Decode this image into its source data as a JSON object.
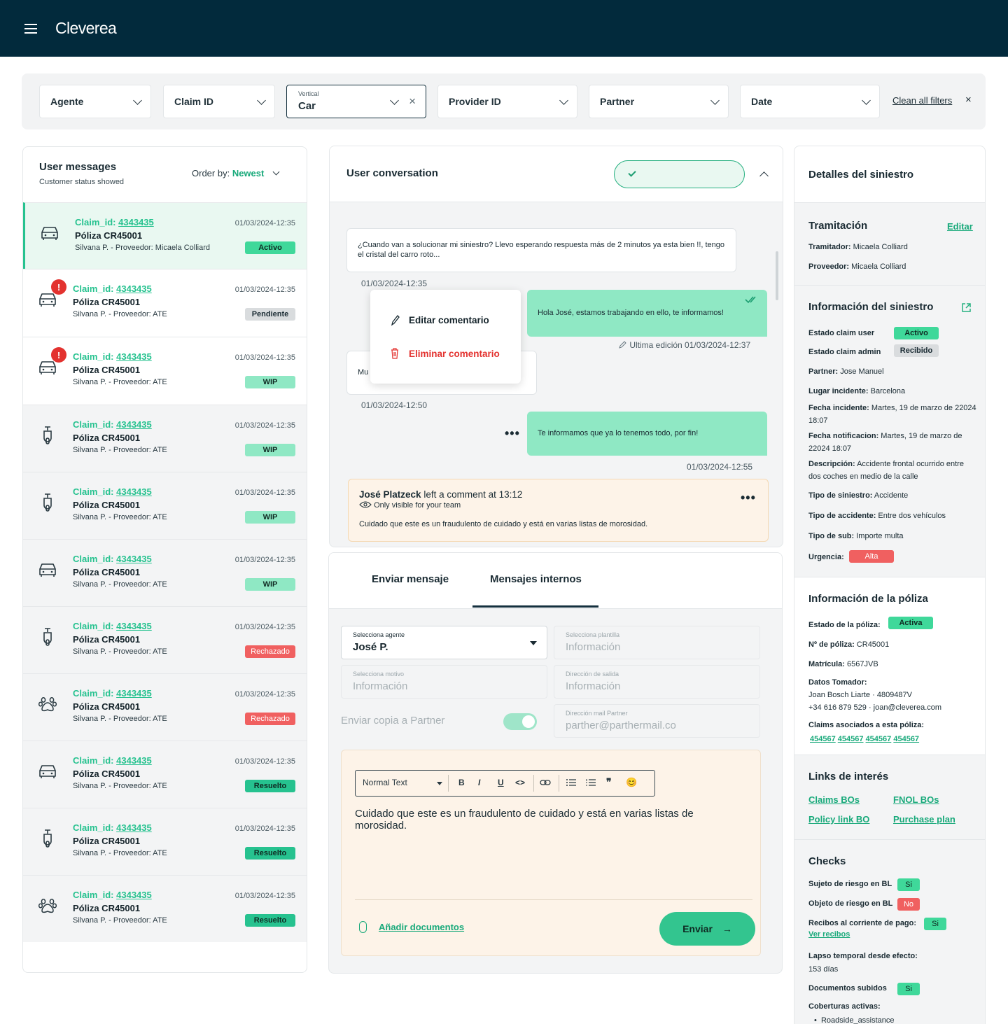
{
  "app": {
    "brand": "Cleverea"
  },
  "colors": {
    "accent": "#26c28f",
    "header_bg": "#022a3c",
    "danger": "#f06060",
    "pending": "#d9dcde"
  },
  "filters": {
    "agente": "Agente",
    "claim_id": "Claim ID",
    "vertical_label": "Vertical",
    "vertical_value": "Car",
    "provider_id": "Provider ID",
    "partner": "Partner",
    "date": "Date",
    "clean": "Clean all filters",
    "clean_x": "×",
    "vertical_x": "×"
  },
  "messages": {
    "title": "User messages",
    "subtitle": "Customer status showed",
    "order_label": "Order by:",
    "order_value": "Newest",
    "items": [
      {
        "prefix": "Claim_id: ",
        "id": "4343435",
        "poliza": "Póliza CR45001",
        "provider": "Silvana P. - Proveedor: Micaela Colliard",
        "date": "01/03/2024-12:35",
        "status": "Activo",
        "icon": "car-icon",
        "alert": ""
      },
      {
        "prefix": "Claim_id: ",
        "id": "4343435",
        "poliza": "Póliza CR45001",
        "provider": "Silvana P. - Proveedor: ATE",
        "date": "01/03/2024-12:35",
        "status": "Pendiente",
        "icon": "car-icon",
        "alert": "!"
      },
      {
        "prefix": "Claim_id: ",
        "id": "4343435",
        "poliza": "Póliza CR45001",
        "provider": "Silvana P. - Proveedor: ATE",
        "date": "01/03/2024-12:35",
        "status": "WIP",
        "icon": "car-icon",
        "alert": "!"
      },
      {
        "prefix": "Claim_id: ",
        "id": "4343435",
        "poliza": "Póliza CR45001",
        "provider": "Silvana P. - Proveedor: ATE",
        "date": "01/03/2024-12:35",
        "status": "WIP",
        "icon": "scooter-icon",
        "alert": ""
      },
      {
        "prefix": "Claim_id: ",
        "id": "4343435",
        "poliza": "Póliza CR45001",
        "provider": "Silvana P. - Proveedor: ATE",
        "date": "01/03/2024-12:35",
        "status": "WIP",
        "icon": "scooter-icon",
        "alert": ""
      },
      {
        "prefix": "Claim_id: ",
        "id": "4343435",
        "poliza": "Póliza CR45001",
        "provider": "Silvana P. - Proveedor: ATE",
        "date": "01/03/2024-12:35",
        "status": "WIP",
        "icon": "car-icon",
        "alert": ""
      },
      {
        "prefix": "Claim_id: ",
        "id": "4343435",
        "poliza": "Póliza CR45001",
        "provider": "Silvana P. - Proveedor: ATE",
        "date": "01/03/2024-12:35",
        "status": "Rechazado",
        "icon": "scooter-icon",
        "alert": ""
      },
      {
        "prefix": "Claim_id: ",
        "id": "4343435",
        "poliza": "Póliza CR45001",
        "provider": "Silvana P. - Proveedor: ATE",
        "date": "01/03/2024-12:35",
        "status": "Rechazado",
        "icon": "paw-icon",
        "alert": ""
      },
      {
        "prefix": "Claim_id: ",
        "id": "4343435",
        "poliza": "Póliza CR45001",
        "provider": "Silvana P. - Proveedor: ATE",
        "date": "01/03/2024-12:35",
        "status": "Resuelto",
        "icon": "car-icon",
        "alert": ""
      },
      {
        "prefix": "Claim_id: ",
        "id": "4343435",
        "poliza": "Póliza CR45001",
        "provider": "Silvana P. - Proveedor: ATE",
        "date": "01/03/2024-12:35",
        "status": "Resuelto",
        "icon": "scooter-icon",
        "alert": ""
      },
      {
        "prefix": "Claim_id: ",
        "id": "4343435",
        "poliza": "Póliza CR45001",
        "provider": "Silvana P. - Proveedor: ATE",
        "date": "01/03/2024-12:35",
        "status": "Resuelto",
        "icon": "paw-icon",
        "alert": ""
      }
    ]
  },
  "conversation": {
    "title": "User conversation",
    "msg1": "¿Cuando van a solucionar mi siniestro? Llevo esperando respuesta más de 2 minutos ya esta bien !!, tengo el cristal del carro roto...",
    "msg1_time": "01/03/2024-12:35",
    "msg2": "Hola José, estamos trabajando en ello, te informamos!",
    "msg2_edit": "Ultima edición 01/03/2024-12:37",
    "msg3_partial": "Mu",
    "msg3_time": "01/03/2024-12:50",
    "msg4": "Te informamos que ya lo tenemos todo, por fin!",
    "msg4_time": "01/03/2024-12:55",
    "menu_edit": "Editar comentario",
    "menu_delete": "Eliminar comentario",
    "dots": "•••",
    "note_author": "José Platzeck",
    "note_action": " left a comment at 13:12",
    "note_visibility": "Only visible for your team",
    "note_text": "Cuidado que este es un fraudulento de cuidado y está en varias listas de morosidad."
  },
  "composer": {
    "tab_send": "Enviar mensaje",
    "tab_internal": "Mensajes internos",
    "agent_label": "Selecciona agente",
    "agent_value": "José P.",
    "template_label": "Selecciona plantilla",
    "template_value": "Información",
    "reason_label": "Selecciona motivo",
    "reason_value": "Información",
    "exit_label": "Dirección de salida",
    "exit_value": "Información",
    "copy_partner": "Enviar copia a Partner",
    "partner_mail_label": "Dirección mail Partner",
    "partner_mail_value": "parther@parthermail.co",
    "text_style": "Normal Text",
    "editor_text": "Cuidado que este es un fraudulento de cuidado y está en varias listas de morosidad.",
    "attach": "Añadir documentos",
    "send": "Enviar",
    "send_arrow": "→",
    "tool_bold": "B",
    "tool_italic": "I",
    "tool_underline": "U",
    "tool_code": "<>",
    "tool_quote": "❞",
    "tool_emoji": "😊"
  },
  "details": {
    "title": "Detalles del siniestro",
    "tram_title": "Tramitación",
    "edit": "Editar",
    "tramitador_k": "Tramitador:",
    "tramitador_v": " Micaela Colliard",
    "proveedor_k": "Proveedor:",
    "proveedor_v": " Micaela Colliard",
    "info_title": "Información del siniestro",
    "estado_user_k": "Estado claim user",
    "estado_user_v": "Activo",
    "estado_admin_k": "Estado claim admin",
    "estado_admin_v": "Recibido",
    "partner_k": "Partner:",
    "partner_v": " Jose Manuel",
    "lugar_k": "Lugar incidente:",
    "lugar_v": " Barcelona",
    "fecha_inc_k": "Fecha incidente:",
    "fecha_inc_v": "  Martes, 19 de marzo de 22024 18:07",
    "fecha_not_k": "Fecha notificacion:",
    "fecha_not_v": "  Martes, 19 de marzo de 22024 18:07",
    "desc_k": "Descripción:",
    "desc_v": " Accidente frontal ocurrido entre dos coches en medio de la calle",
    "tipo_sin_k": "Tipo de siniestro:",
    "tipo_sin_v": " Accidente",
    "tipo_acc_k": "Tipo de accidente:",
    "tipo_acc_v": " Entre dos vehículos",
    "tipo_sub_k": "Tipo de sub:",
    "tipo_sub_v": " Importe multa",
    "urgencia_k": "Urgencia:",
    "urgencia_v": "Alta",
    "poliza_title": "Información de la póliza",
    "estado_pol_k": "Estado de la póliza:",
    "estado_pol_v": "Activa",
    "num_pol_k": "Nº de póliza:",
    "num_pol_v": " CR45001",
    "matricula_k": "Matrícula:",
    "matricula_v": " 6567JVB",
    "tomador_k": "Datos Tomador:",
    "tomador_l1": "Joan Bosch Liarte · 4809487V",
    "tomador_l2": "+34 616 879 529 · joan@cleverea.com",
    "claims_k": "Claims asociados a esta póliza:",
    "claims_v": [
      "454567",
      "454567",
      "454567",
      "454567"
    ],
    "links_title": "Links de interés",
    "link1": "Claims BOs",
    "link2": "FNOL BOs",
    "link3": "Policy link BO",
    "link4": "Purchase plan",
    "checks_title": "Checks",
    "chk1_k": "Sujeto de riesgo en BL",
    "chk1_v": "Si",
    "chk2_k": "Objeto de riesgo en BL",
    "chk2_v": "No",
    "chk3_k": "Recibos al corriente de pago:",
    "chk3_v": "Si",
    "ver_recibos": "Ver recibos",
    "lapso_k": "Lapso temporal desde efecto:",
    "lapso_v": "153 días",
    "docs_k": "Documentos subidos",
    "docs_v": "Si",
    "cob_k": "Coberturas activas:",
    "cob_v": "Roadside_assistance"
  }
}
